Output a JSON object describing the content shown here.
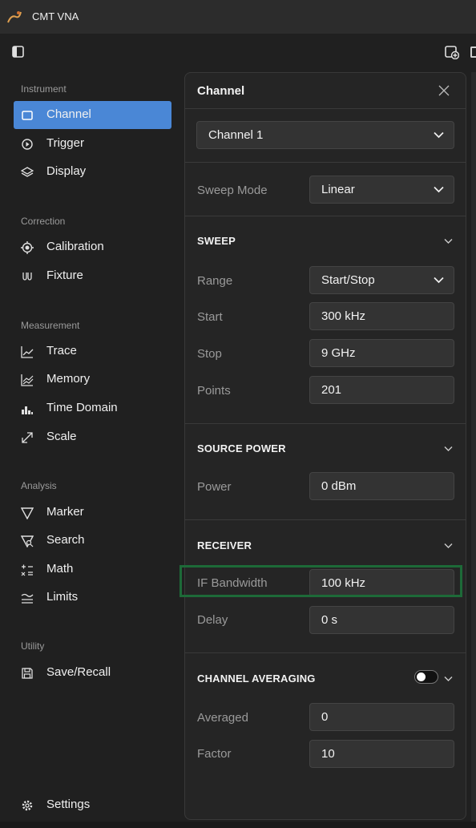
{
  "app": {
    "title": "CMT VNA"
  },
  "sidebar": {
    "sections": {
      "instrument": "Instrument",
      "correction": "Correction",
      "measurement": "Measurement",
      "analysis": "Analysis",
      "utility": "Utility"
    },
    "items": {
      "channel": "Channel",
      "trigger": "Trigger",
      "display": "Display",
      "calibration": "Calibration",
      "fixture": "Fixture",
      "trace": "Trace",
      "memory": "Memory",
      "time_domain": "Time Domain",
      "scale": "Scale",
      "marker": "Marker",
      "search": "Search",
      "math": "Math",
      "limits": "Limits",
      "save_recall": "Save/Recall",
      "settings": "Settings"
    },
    "active": "Channel"
  },
  "panel": {
    "title": "Channel",
    "channel_select": "Channel 1",
    "sweep_mode": {
      "label": "Sweep Mode",
      "value": "Linear"
    },
    "sweep": {
      "header": "SWEEP",
      "range": {
        "label": "Range",
        "value": "Start/Stop"
      },
      "start": {
        "label": "Start",
        "value": "300 kHz"
      },
      "stop": {
        "label": "Stop",
        "value": "9 GHz"
      },
      "points": {
        "label": "Points",
        "value": "201"
      }
    },
    "source_power": {
      "header": "SOURCE POWER",
      "power": {
        "label": "Power",
        "value": "0 dBm"
      }
    },
    "receiver": {
      "header": "RECEIVER",
      "if_bandwidth": {
        "label": "IF Bandwidth",
        "value": "100 kHz"
      },
      "delay": {
        "label": "Delay",
        "value": "0 s"
      }
    },
    "averaging": {
      "header": "CHANNEL AVERAGING",
      "enabled": false,
      "averaged": {
        "label": "Averaged",
        "value": "0"
      },
      "factor": {
        "label": "Factor",
        "value": "10"
      }
    }
  },
  "colors": {
    "accent": "#4a87d6",
    "highlight_border": "#1d6a38"
  }
}
